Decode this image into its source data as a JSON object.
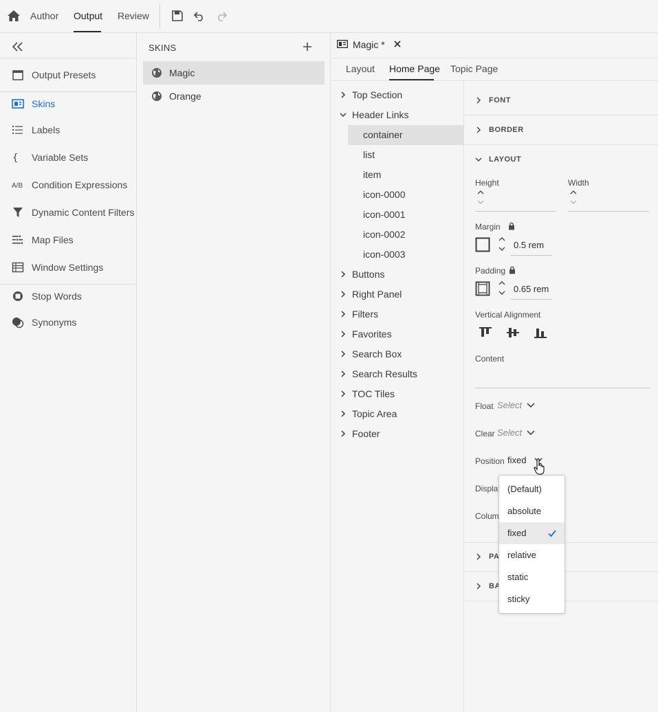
{
  "topbar": {
    "tabs": [
      "Author",
      "Output",
      "Review"
    ],
    "active_tab": "Output"
  },
  "leftnav": {
    "items": [
      {
        "label": "Output Presets",
        "icon": "output-presets-icon"
      },
      {
        "label": "Skins",
        "icon": "skins-icon",
        "active": true
      },
      {
        "label": "Labels",
        "icon": "labels-icon"
      },
      {
        "label": "Variable Sets",
        "icon": "braces-icon"
      },
      {
        "label": "Condition Expressions",
        "icon": "ab-icon"
      },
      {
        "label": "Dynamic Content Filters",
        "icon": "filter-icon"
      },
      {
        "label": "Map Files",
        "icon": "map-files-icon"
      },
      {
        "label": "Window Settings",
        "icon": "table-icon"
      },
      {
        "label": "Stop Words",
        "icon": "stop-icon"
      },
      {
        "label": "Synonyms",
        "icon": "synonyms-icon"
      }
    ]
  },
  "skins": {
    "header": "SKINS",
    "items": [
      {
        "label": "Magic",
        "selected": true
      },
      {
        "label": "Orange"
      }
    ]
  },
  "editor": {
    "doc_tab": "Magic *",
    "subtabs": [
      "Layout",
      "Home Page",
      "Topic Page"
    ],
    "active_subtab": "Home Page",
    "tree": [
      {
        "label": "Top Section",
        "level": 0,
        "expanded": false
      },
      {
        "label": "Header Links",
        "level": 0,
        "expanded": true
      },
      {
        "label": "container",
        "level": 1,
        "selected": true
      },
      {
        "label": "list",
        "level": 1
      },
      {
        "label": "item",
        "level": 1
      },
      {
        "label": "icon-0000",
        "level": 1
      },
      {
        "label": "icon-0001",
        "level": 1
      },
      {
        "label": "icon-0002",
        "level": 1
      },
      {
        "label": "icon-0003",
        "level": 1
      },
      {
        "label": "Buttons",
        "level": 0,
        "expanded": false
      },
      {
        "label": "Right Panel",
        "level": 0,
        "expanded": false
      },
      {
        "label": "Filters",
        "level": 0,
        "expanded": false
      },
      {
        "label": "Favorites",
        "level": 0,
        "expanded": false
      },
      {
        "label": "Search Box",
        "level": 0,
        "expanded": false
      },
      {
        "label": "Search Results",
        "level": 0,
        "expanded": false
      },
      {
        "label": "TOC Tiles",
        "level": 0,
        "expanded": false
      },
      {
        "label": "Topic Area",
        "level": 0,
        "expanded": false
      },
      {
        "label": "Footer",
        "level": 0,
        "expanded": false
      }
    ]
  },
  "props": {
    "font": "FONT",
    "border": "BORDER",
    "layout": "LAYOUT",
    "height_label": "Height",
    "width_label": "Width",
    "margin_label": "Margin",
    "margin_value": "0.5 rem",
    "padding_label": "Padding",
    "padding_value": "0.65 rem",
    "valign_label": "Vertical Alignment",
    "content_label": "Content",
    "float_label": "Float",
    "float_placeholder": "Select",
    "clear_label": "Clear",
    "clear_placeholder": "Select",
    "position_label": "Position",
    "position_value": "fixed",
    "display_label": "Display",
    "columns_label": "Columns",
    "pa_label": "PA",
    "ba_label": "BA"
  },
  "dropdown": {
    "options": [
      "(Default)",
      "absolute",
      "fixed",
      "relative",
      "static",
      "sticky"
    ],
    "selected": "fixed"
  },
  "colors": {
    "accent": "#1473e6",
    "background": "#f5f5f5",
    "selection": "#e1e1e1"
  }
}
